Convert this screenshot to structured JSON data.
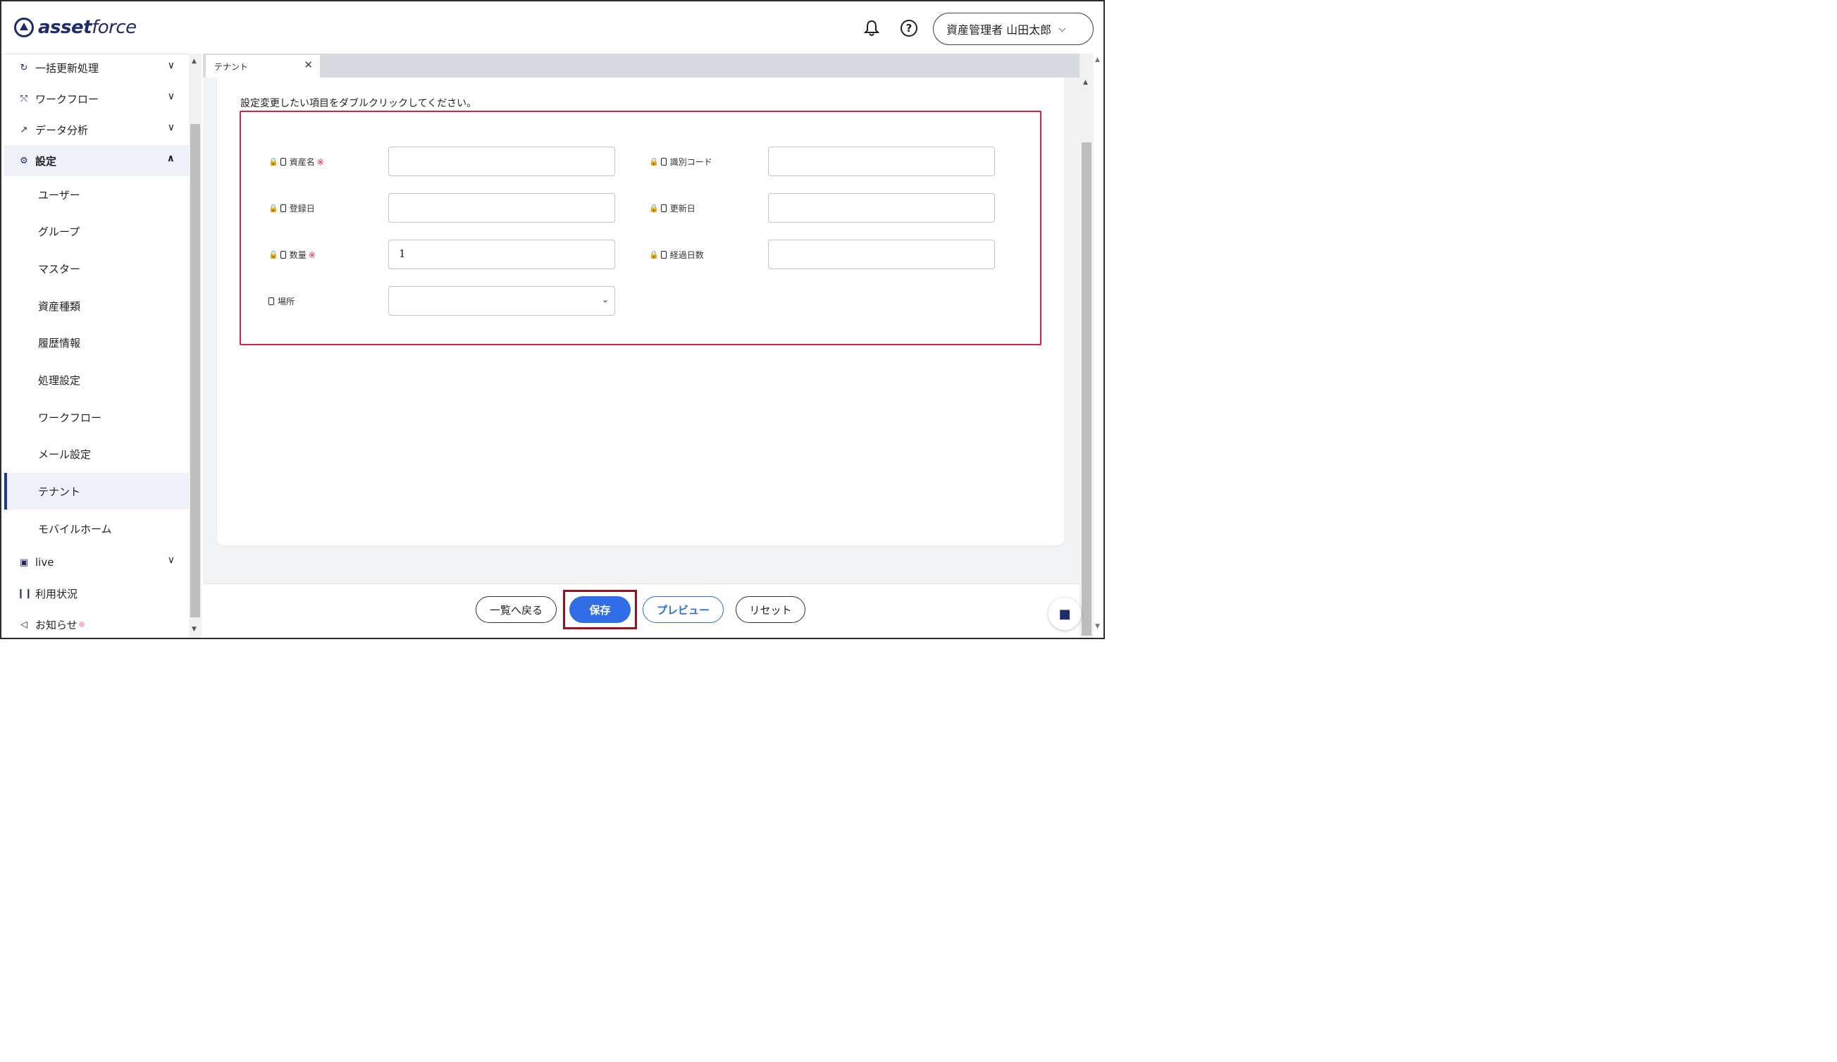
{
  "header": {
    "logo_bold": "asset",
    "logo_light": "force",
    "user_label": "資産管理者 山田太郎",
    "help_glyph": "?"
  },
  "sidebar": {
    "items": [
      {
        "label": "一括更新処理",
        "icon": "refresh-icon"
      },
      {
        "label": "ワークフロー",
        "icon": "workflow-icon"
      },
      {
        "label": "データ分析",
        "icon": "analytics-icon"
      },
      {
        "label": "設定",
        "icon": "gear-icon"
      }
    ],
    "settings_sub": [
      "ユーザー",
      "グループ",
      "マスター",
      "資産種類",
      "履歴情報",
      "処理設定",
      "ワークフロー",
      "メール設定",
      "テナント",
      "モバイルホーム"
    ],
    "bottom_items": [
      {
        "label": "live",
        "icon": "live-icon"
      },
      {
        "label": "利用状況",
        "icon": "usage-icon"
      },
      {
        "label": "お知らせ",
        "icon": "megaphone-icon"
      }
    ]
  },
  "tab": {
    "label": "テナント"
  },
  "form": {
    "instruction": "設定変更したい項目をダブルクリックしてください。",
    "required_mark": "※",
    "fields": {
      "asset_name": {
        "label": "資産名",
        "value": ""
      },
      "id_code": {
        "label": "識別コード",
        "value": ""
      },
      "registered_date": {
        "label": "登録日",
        "value": ""
      },
      "updated_date": {
        "label": "更新日",
        "value": ""
      },
      "quantity": {
        "label": "数量",
        "value": "1"
      },
      "elapsed_days": {
        "label": "経過日数",
        "value": ""
      },
      "location": {
        "label": "場所",
        "value": ""
      }
    }
  },
  "footer": {
    "back_label": "一覧へ戻る",
    "save_label": "保存",
    "preview_label": "プレビュー",
    "reset_label": "リセット"
  },
  "colors": {
    "brand": "#1e2b6f",
    "primary": "#2f6ee6",
    "highlight": "#d4204a",
    "save_highlight": "#9b1020"
  }
}
